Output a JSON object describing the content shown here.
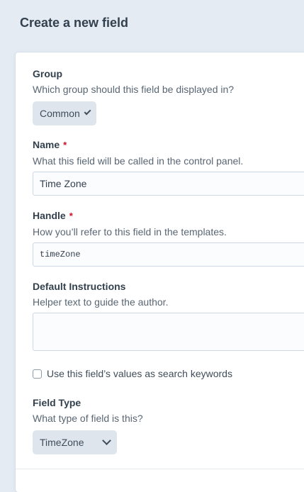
{
  "header": {
    "title": "Create a new field"
  },
  "group": {
    "label": "Group",
    "instructions": "Which group should this field be displayed in?",
    "selected": "Common"
  },
  "name": {
    "label": "Name",
    "required_mark": "*",
    "instructions": "What this field will be called in the control panel.",
    "value": "Time Zone"
  },
  "handle": {
    "label": "Handle",
    "required_mark": "*",
    "instructions": "How you’ll refer to this field in the templates.",
    "value": "timeZone"
  },
  "default_instructions": {
    "label": "Default Instructions",
    "instructions": "Helper text to guide the author.",
    "value": ""
  },
  "search_keywords": {
    "label": "Use this field’s values as search keywords",
    "checked": false
  },
  "field_type": {
    "label": "Field Type",
    "instructions": "What type of field is this?",
    "selected": "TimeZone"
  },
  "colors": {
    "background": "#e4ebf3",
    "card": "#ffffff",
    "required": "#cf1124",
    "select_bg": "#dfe5ec"
  }
}
